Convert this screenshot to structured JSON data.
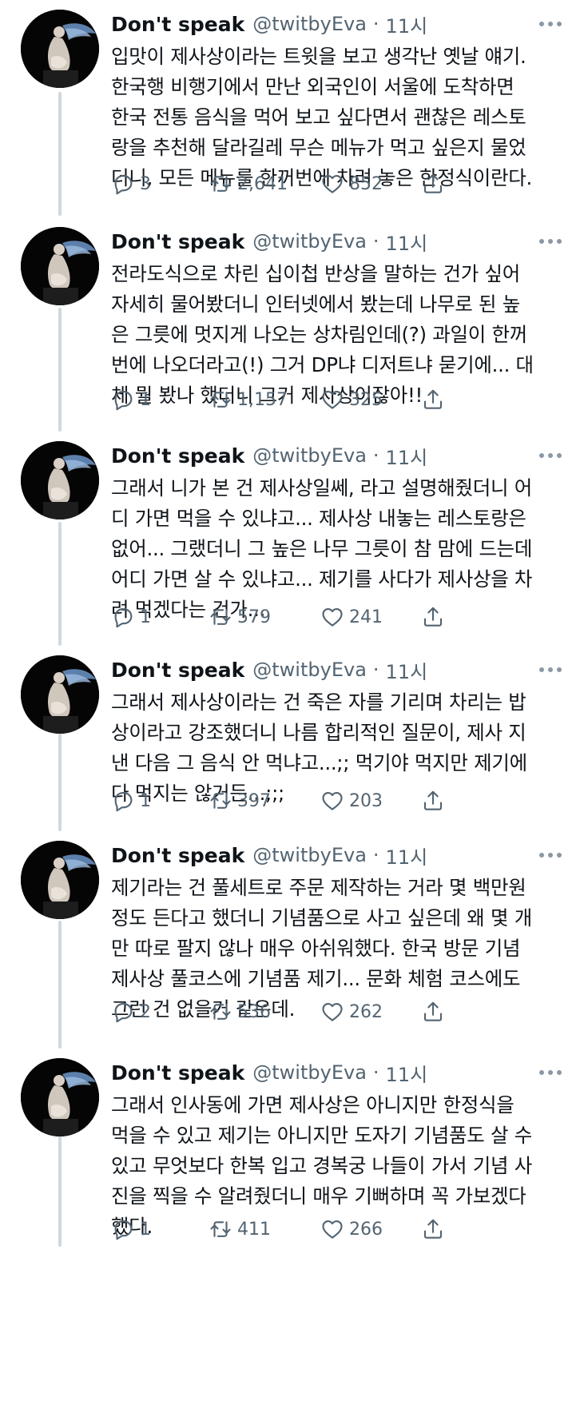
{
  "tweets": [
    {
      "name": "Don't speak",
      "handle": "@twitbyEva",
      "dot": "·",
      "time": "11시",
      "lines": [
        "입맛이 제사상이라는 트윗을 보고 생각난 옛날 얘기.",
        "한국행 비행기에서 만난 외국인이 서울에 도착하면",
        "한국 전통 음식을 먹어 보고 싶다면서 괜찮은 레스토",
        "랑을 추천해 달라길레 무슨 메뉴가 먹고 싶은지 물었",
        "더니, 모든 메뉴를 한꺼번에 차려 놓은 한정식이란다."
      ],
      "replies": "3",
      "retweets": "2,641",
      "likes": "852"
    },
    {
      "name": "Don't speak",
      "handle": "@twitbyEva",
      "dot": "·",
      "time": "11시",
      "lines": [
        "전라도식으로 차린 십이첩 반상을 말하는 건가 싶어",
        "자세히 물어봤더니 인터넷에서 봤는데 나무로 된 높",
        "은 그릇에 멋지게 나오는 상차림인데(?) 과일이 한꺼",
        "번에 나오더라고(!) 그거 DP냐 디저트냐 묻기에... 대",
        "체 뭘 봤나 했더니 그거 제사상이잖아!!"
      ],
      "replies": "1",
      "retweets": "1,157",
      "likes": "325"
    },
    {
      "name": "Don't speak",
      "handle": "@twitbyEva",
      "dot": "·",
      "time": "11시",
      "lines": [
        "그래서 니가 본 건 제사상일쎄, 라고 설명해줬더니 어",
        "디 가면 먹을 수 있냐고... 제사상 내놓는 레스토랑은",
        "없어... 그랬더니 그 높은 나무 그릇이 참 맘에 드는데",
        "어디 가면 살 수 있냐고... 제기를 사다가 제사상을 차",
        "려 먹겠다는 건가..."
      ],
      "replies": "1",
      "retweets": "579",
      "likes": "241"
    },
    {
      "name": "Don't speak",
      "handle": "@twitbyEva",
      "dot": "·",
      "time": "11시",
      "lines": [
        "그래서 제사상이라는 건 죽은 자를 기리며 차리는 밥",
        "상이라고 강조했더니 나름 합리적인 질문이, 제사 지",
        "낸 다음 그 음식 안 먹냐고...;; 먹기야 먹지만 제기에",
        "다 먹지는 않거든...;;;"
      ],
      "replies": "1",
      "retweets": "397",
      "likes": "203"
    },
    {
      "name": "Don't speak",
      "handle": "@twitbyEva",
      "dot": "·",
      "time": "11시",
      "lines": [
        "제기라는 건 풀세트로 주문 제작하는 거라 몇 백만원",
        "정도 든다고 했더니 기념품으로 사고 싶은데 왜 몇 개",
        "만 따로 팔지 않나 매우 아쉬워했다. 한국 방문 기념",
        "제사상 풀코스에 기념품 제기... 문화 체험 코스에도",
        "그런 건 없을거 같은데."
      ],
      "replies": "2",
      "retweets": "536",
      "likes": "262"
    },
    {
      "name": "Don't speak",
      "handle": "@twitbyEva",
      "dot": "·",
      "time": "11시",
      "lines": [
        "그래서 인사동에 가면 제사상은 아니지만 한정식을",
        "먹을 수 있고 제기는 아니지만 도자기 기념품도 살 수",
        "있고 무엇보다 한복 입고 경복궁 나들이 가서 기념 사",
        "진을 찍을 수 알려줬더니 매우 기뻐하며 꼭 가보겠다",
        "했다."
      ],
      "replies": "1",
      "retweets": "411",
      "likes": "266"
    }
  ],
  "icons": {
    "reply": "reply-icon",
    "retweet": "retweet-icon",
    "like": "heart-icon",
    "share": "share-icon",
    "more": "more-icon"
  },
  "colors": {
    "text": "#0f1419",
    "muted": "#536471",
    "thread_line": "#cfd9de"
  }
}
